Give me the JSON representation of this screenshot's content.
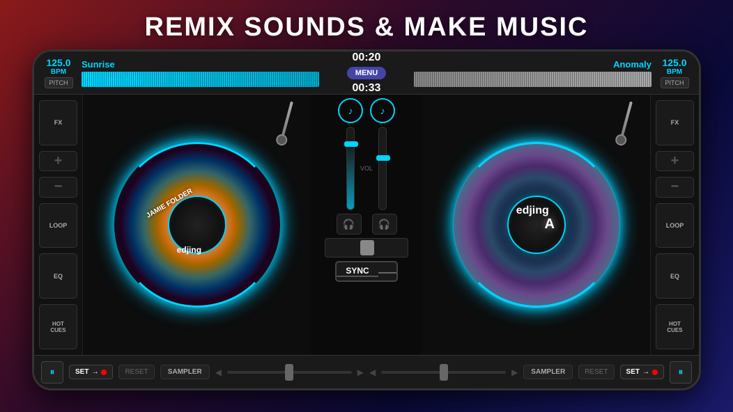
{
  "title": "REMIX SOUNDS & MAKE MUSIC",
  "header": {
    "left_bpm": "125.0",
    "left_bpm_label": "BPM",
    "left_pitch_label": "PITCH",
    "left_track": "Sunrise",
    "left_time": "00:20",
    "menu_label": "MENU",
    "right_track": "Anomaly",
    "right_time": "00:33",
    "right_bpm": "125.0",
    "right_bpm_label": "BPM",
    "right_pitch_label": "PITCH"
  },
  "left_panel": {
    "fx": "FX",
    "loop": "LOOP",
    "eq": "EQ",
    "hot_cues": "HOT\nCUES"
  },
  "right_panel": {
    "fx": "FX",
    "loop": "LOOP",
    "eq": "EQ",
    "hot_cues": "HOT\nCUES"
  },
  "mixer": {
    "vol_label": "VOL",
    "sync_label": "SYNC"
  },
  "bottom_left": {
    "pause": "⏸",
    "set": "SET",
    "reset": "RESET",
    "sampler": "SAMPLER"
  },
  "bottom_right": {
    "sampler": "SAMPLER",
    "reset": "RESET",
    "set": "SET",
    "pause": "⏸"
  },
  "turntable_left": {
    "label": "JAMIE FOLDER",
    "sublabel": "edjing"
  },
  "turntable_right": {
    "label": "edjing"
  }
}
